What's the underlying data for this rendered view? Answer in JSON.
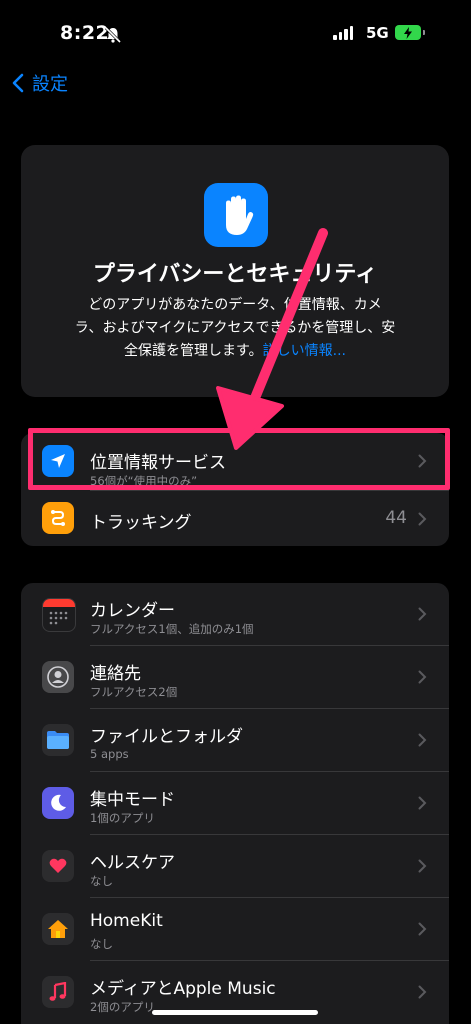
{
  "status_bar": {
    "time": "8:22",
    "network": "5G"
  },
  "nav": {
    "back_label": "設定"
  },
  "header": {
    "title": "プライバシーとセキュリティ",
    "description_line1": "どのアプリがあなたのデータ、位置情報、カメ",
    "description_line2": "ラ、およびマイクにアクセスできるかを管理し、安",
    "description_line3": "全保護を管理します。",
    "link_label": "詳しい情報..."
  },
  "group1": [
    {
      "title": "位置情報サービス",
      "subtitle": "56個が“使用中のみ”",
      "icon": "location-arrow-icon",
      "color": "#0a84ff"
    },
    {
      "title": "トラッキング",
      "value": "44",
      "icon": "tracking-icon",
      "color": "#ff9f0a"
    }
  ],
  "group2": [
    {
      "title": "カレンダー",
      "subtitle": "フルアクセス1個、追加のみ1個",
      "icon": "calendar-icon"
    },
    {
      "title": "連絡先",
      "subtitle": "フルアクセス2個",
      "icon": "contacts-icon"
    },
    {
      "title": "ファイルとフォルダ",
      "subtitle": "5 apps",
      "icon": "folder-icon"
    },
    {
      "title": "集中モード",
      "subtitle": "1個のアプリ",
      "icon": "moon-icon"
    },
    {
      "title": "ヘルスケア",
      "subtitle": "なし",
      "icon": "heart-icon"
    },
    {
      "title": "HomeKit",
      "subtitle": "なし",
      "icon": "home-icon"
    },
    {
      "title": "メディアとApple Music",
      "subtitle": "2個のアプリ",
      "icon": "music-note-icon"
    }
  ],
  "annotation": {
    "color": "#ff2d6f"
  }
}
